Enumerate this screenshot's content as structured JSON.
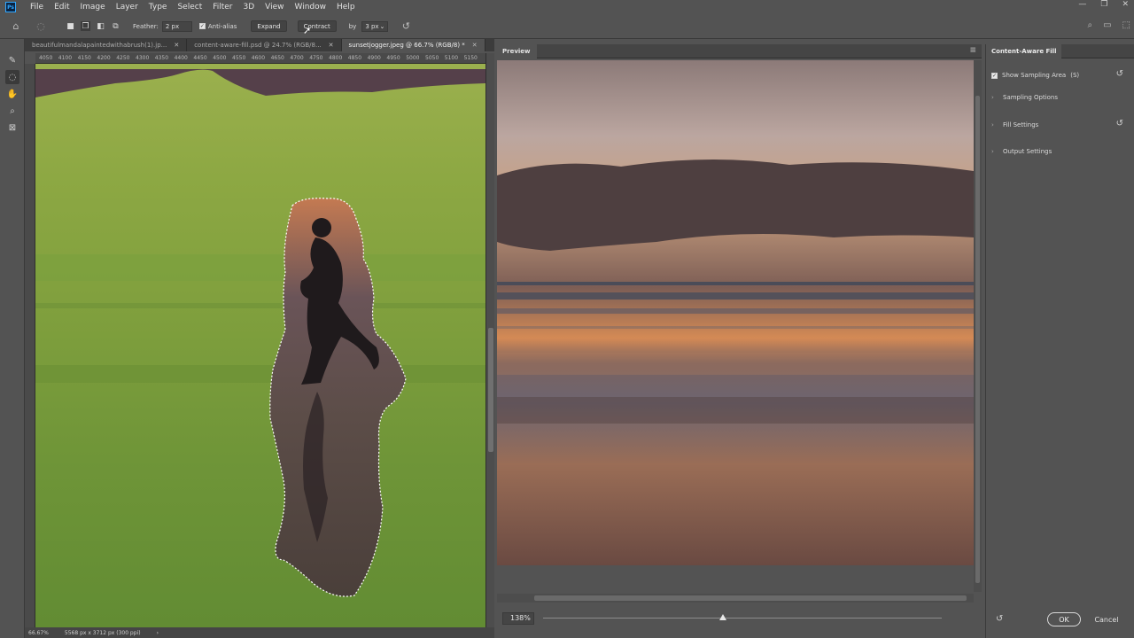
{
  "app": {
    "logo": "Ps"
  },
  "menu": [
    "File",
    "Edit",
    "Image",
    "Layer",
    "Type",
    "Select",
    "Filter",
    "3D",
    "View",
    "Window",
    "Help"
  ],
  "window_controls": [
    "—",
    "❐",
    "✕"
  ],
  "options": {
    "feather_label": "Feather:",
    "feather_value": "2 px",
    "antialias_label": "Anti-alias",
    "antialias_checked": true,
    "expand_label": "Expand",
    "contract_label": "Contract",
    "by_label": "by",
    "by_value": "3 px"
  },
  "tabs": [
    {
      "label": "beautifulmandalapaintedwithabrush(1).jp...",
      "active": false
    },
    {
      "label": "content-aware-fill.psd @ 24.7% (RGB/8...",
      "active": false
    },
    {
      "label": "sunsetjogger.jpeg @ 66.7% (RGB/8) *",
      "active": true
    }
  ],
  "ruler_ticks": [
    "4050",
    "4100",
    "4150",
    "4200",
    "4250",
    "4300",
    "4350",
    "4400",
    "4450",
    "4500",
    "4550",
    "4600",
    "4650",
    "4700",
    "4750",
    "4800",
    "4850",
    "4900",
    "4950",
    "5000",
    "5050",
    "5100",
    "5150"
  ],
  "status": {
    "zoom": "66.67%",
    "doc_info": "5568 px x 3712 px (300 ppi)"
  },
  "preview": {
    "title": "Preview",
    "zoom": "138%",
    "zoom_slider_fraction": 0.45
  },
  "panel": {
    "title": "Content-Aware Fill",
    "show_sampling_area": "Show Sampling Area",
    "shortcut": "(S)",
    "sampling_options": "Sampling Options",
    "fill_settings": "Fill Settings",
    "output_settings": "Output Settings"
  },
  "buttons": {
    "ok": "OK",
    "cancel": "Cancel"
  },
  "colors": {
    "sampling_overlay": "#8da843",
    "accent": "#31a8ff"
  }
}
